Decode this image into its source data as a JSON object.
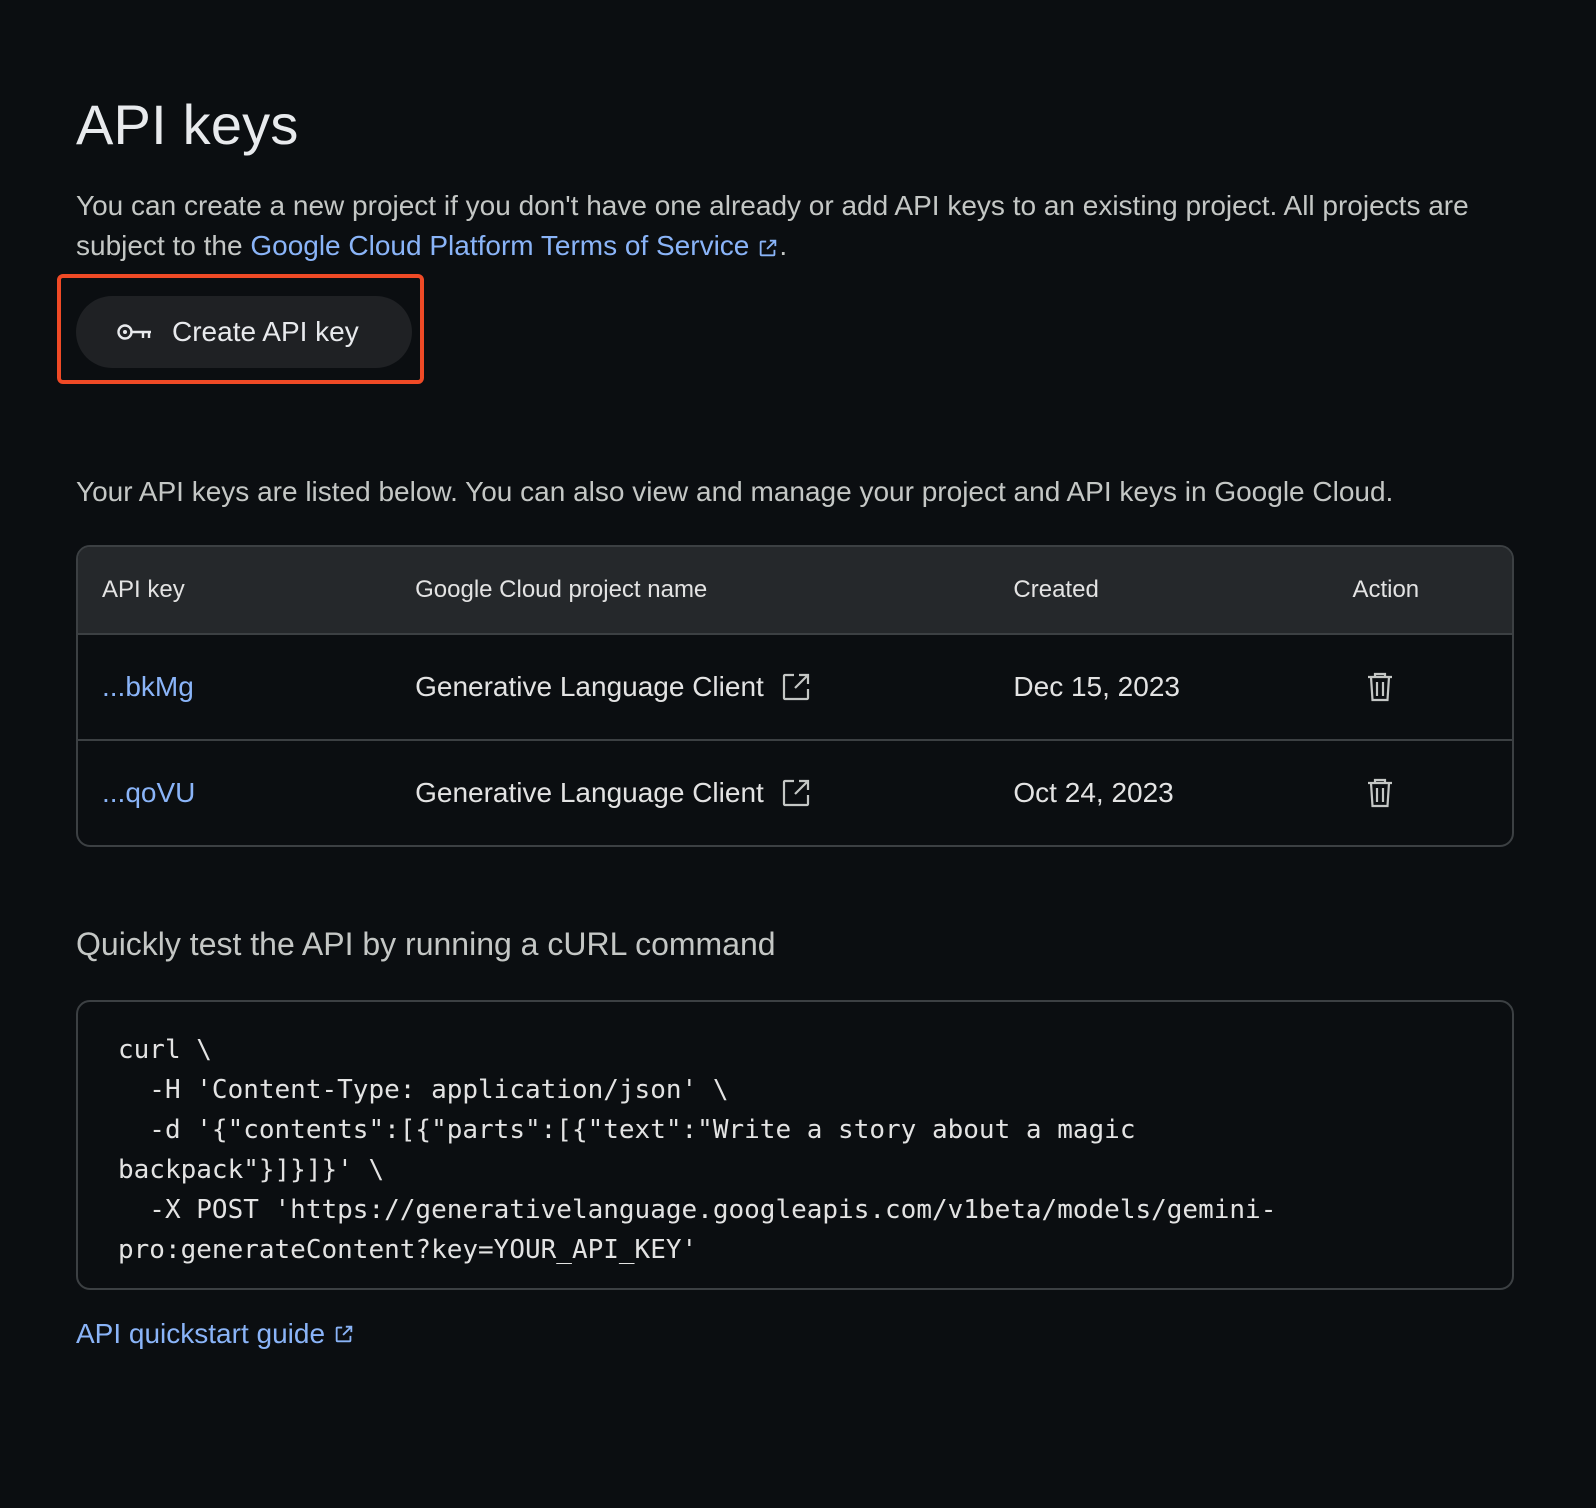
{
  "page": {
    "title": "API keys",
    "intro_text": "You can create a new project if you don't have one already or add API keys to an existing project. All projects are subject to the ",
    "terms_link": "Google Cloud Platform Terms of Service",
    "intro_end": ".",
    "create_button_label": "Create API key",
    "list_intro": "Your API keys are listed below. You can also view and manage your project and API keys in Google Cloud."
  },
  "table": {
    "headers": {
      "key": "API key",
      "project": "Google Cloud project name",
      "created": "Created",
      "action": "Action"
    },
    "rows": [
      {
        "key": "...bkMg",
        "project": "Generative Language Client",
        "created": "Dec 15, 2023"
      },
      {
        "key": "...qoVU",
        "project": "Generative Language Client",
        "created": "Oct 24, 2023"
      }
    ]
  },
  "curl_section": {
    "title": "Quickly test the API by running a cURL command",
    "code": "curl \\\n  -H 'Content-Type: application/json' \\\n  -d '{\"contents\":[{\"parts\":[{\"text\":\"Write a story about a magic\nbackpack\"}]}]}' \\\n  -X POST 'https://generativelanguage.googleapis.com/v1beta/models/gemini-\npro:generateContent?key=YOUR_API_KEY'",
    "quickstart_link": "API quickstart guide"
  },
  "icons": {
    "create": "key-icon",
    "external": "external-link-icon",
    "delete": "trash-icon"
  },
  "colors": {
    "background": "#0b0e11",
    "link": "#8ab4f8",
    "highlight": "#f04a26",
    "border": "#3c4043"
  }
}
